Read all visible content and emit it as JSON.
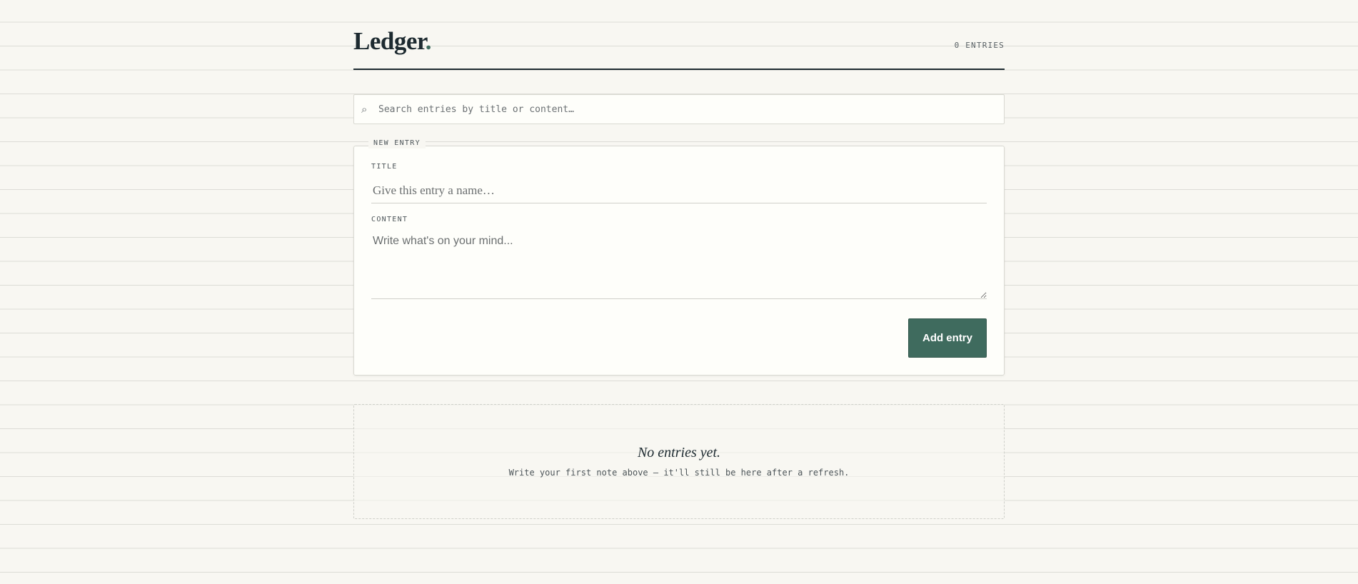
{
  "header": {
    "brand": "Ledger",
    "brand_dot": ".",
    "entry_count": "0 ENTRIES"
  },
  "search": {
    "icon": "search-icon",
    "placeholder": "Search entries by title or content…"
  },
  "new_entry": {
    "legend": "NEW ENTRY",
    "title_label": "TITLE",
    "title_placeholder": "Give this entry a name…",
    "content_label": "CONTENT",
    "content_placeholder": "Write what's on your mind...",
    "add_button": "Add entry"
  },
  "empty_state": {
    "title": "No entries yet.",
    "subtitle": "Write your first note above — it'll still be here after a refresh."
  },
  "colors": {
    "background": "#f8f7f2",
    "ink": "#1d2a30",
    "accent": "#3f6b5e",
    "card": "#fefefa"
  }
}
